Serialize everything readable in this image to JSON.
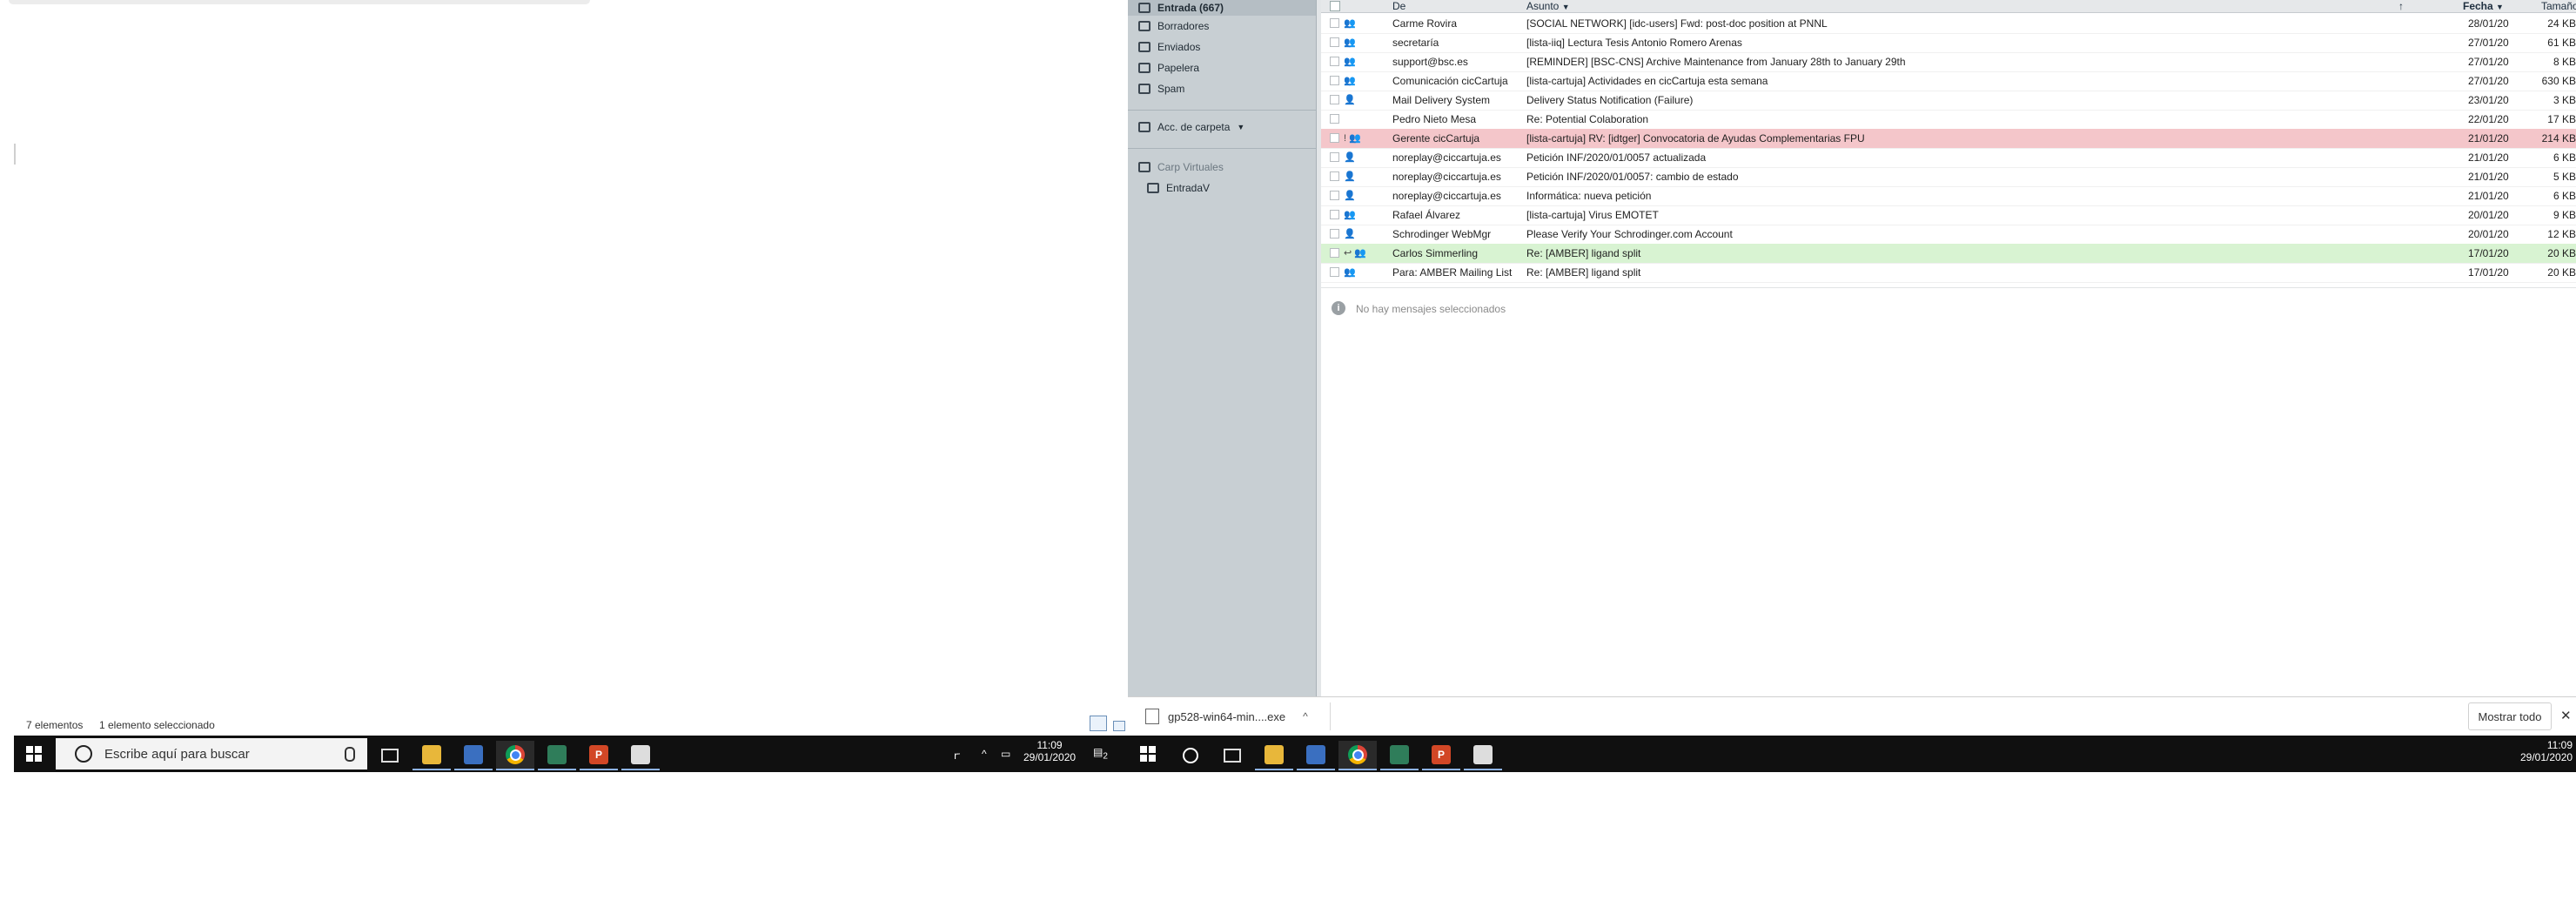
{
  "explorer": {
    "status_count": "7 elementos",
    "status_selected": "1 elemento seleccionado"
  },
  "taskbar": {
    "search_placeholder": "Escribe aquí para buscar",
    "time": "11:09",
    "date": "29/01/2020",
    "notification_count": "2",
    "icons": [
      "windows-icon",
      "search-icon",
      "task-view-icon",
      "file-explorer-icon",
      "network-app-icon",
      "chrome-icon",
      "app-icon",
      "powerpoint-icon",
      "image-app-icon"
    ]
  },
  "mail": {
    "folders": [
      {
        "label": "Entrada (667)",
        "icon": "inbox-icon"
      },
      {
        "label": "Borradores",
        "icon": "drafts-icon"
      },
      {
        "label": "Enviados",
        "icon": "sent-icon"
      },
      {
        "label": "Papelera",
        "icon": "trash-icon"
      },
      {
        "label": "Spam",
        "icon": "spam-icon"
      }
    ],
    "folder_actions": "Acc. de carpeta",
    "virtual_title": "Carp Virtuales",
    "virtual_inbox": "EntradaV",
    "columns": {
      "from": "De",
      "subject": "Asunto",
      "date": "Fecha",
      "size": "Tamaño"
    },
    "messages": [
      {
        "from": "Carme Rovira",
        "subject": "[SOCIAL NETWORK] [idc-users] Fwd: post-doc position at PNNL",
        "date": "28/01/20",
        "size": "24 KB",
        "icon": "group-icon",
        "state": "normal"
      },
      {
        "from": "secretaría",
        "subject": "[lista-iiq] Lectura Tesis Antonio Romero Arenas",
        "date": "27/01/20",
        "size": "61 KB",
        "icon": "group-icon",
        "state": "normal"
      },
      {
        "from": "support@bsc.es",
        "subject": "[REMINDER] [BSC-CNS] Archive Maintenance from January 28th to January 29th",
        "date": "27/01/20",
        "size": "8 KB",
        "icon": "group-icon",
        "state": "normal"
      },
      {
        "from": "Comunicación cicCartuja",
        "subject": "[lista-cartuja] Actividades en cicCartuja esta semana",
        "date": "27/01/20",
        "size": "630 KB",
        "icon": "group-icon",
        "state": "normal"
      },
      {
        "from": "Mail Delivery System",
        "subject": "Delivery Status Notification (Failure)",
        "date": "23/01/20",
        "size": "3 KB",
        "icon": "person-icon",
        "state": "normal"
      },
      {
        "from": "Pedro Nieto Mesa",
        "subject": "Re: Potential Colaboration",
        "date": "22/01/20",
        "size": "17 KB",
        "icon": "",
        "state": "normal"
      },
      {
        "from": "Gerente cicCartuja",
        "subject": "[lista-cartuja] RV: [idtger] Convocatoria de Ayudas Complementarias FPU",
        "date": "21/01/20",
        "size": "214 KB",
        "icon": "alert-group-icon",
        "state": "alert"
      },
      {
        "from": "noreplay@ciccartuja.es",
        "subject": "Petición INF/2020/01/0057 actualizada",
        "date": "21/01/20",
        "size": "6 KB",
        "icon": "person-icon",
        "state": "normal"
      },
      {
        "from": "noreplay@ciccartuja.es",
        "subject": "Petición INF/2020/01/0057: cambio de estado",
        "date": "21/01/20",
        "size": "5 KB",
        "icon": "person-icon",
        "state": "normal"
      },
      {
        "from": "noreplay@ciccartuja.es",
        "subject": "Informática: nueva petición",
        "date": "21/01/20",
        "size": "6 KB",
        "icon": "person-icon",
        "state": "normal"
      },
      {
        "from": "Rafael Álvarez",
        "subject": "[lista-cartuja] Virus EMOTET",
        "date": "20/01/20",
        "size": "9 KB",
        "icon": "group-icon",
        "state": "normal"
      },
      {
        "from": "Schrodinger WebMgr",
        "subject": "Please Verify Your Schrodinger.com Account",
        "date": "20/01/20",
        "size": "12 KB",
        "icon": "person-icon",
        "state": "normal"
      },
      {
        "from": "Carlos Simmerling",
        "subject": "Re: [AMBER] ligand split",
        "date": "17/01/20",
        "size": "20 KB",
        "icon": "reply-group-icon",
        "state": "green"
      },
      {
        "from": "Para: AMBER Mailing List",
        "subject": "Re: [AMBER] ligand split",
        "date": "17/01/20",
        "size": "20 KB",
        "icon": "group-icon",
        "state": "normal"
      }
    ],
    "preview_empty": "No hay mensajes seleccionados"
  },
  "downloads": {
    "file": "gp528-win64-min....exe",
    "show_all": "Mostrar todo"
  }
}
